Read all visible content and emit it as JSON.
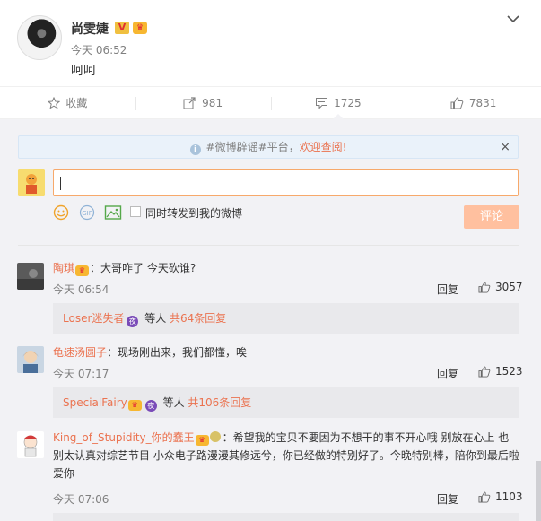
{
  "post": {
    "author": "尚雯婕",
    "vip_badge": "V",
    "time": "今天 06:52",
    "text": "呵呵"
  },
  "actions": {
    "favorite": "收藏",
    "repost": "981",
    "comment": "1725",
    "like": "7831"
  },
  "notice": {
    "prefix": "#微博辟谣#平台，",
    "link": "欢迎查阅!",
    "close": "×"
  },
  "composer": {
    "sync_label": "同时转发到我的微博",
    "submit_label": "评论"
  },
  "comments": [
    {
      "user": "陶琪",
      "text": "：大哥咋了 今天砍谁?",
      "time": "今天 06:54",
      "reply_label": "回复",
      "likes": "3057",
      "sub_user": "Loser迷失者",
      "sub_mid": " 等人 ",
      "sub_more": "共64条回复"
    },
    {
      "user": "龟速汤圆子",
      "text": "：现场刚出来，我们都懂，唉",
      "time": "今天 07:17",
      "reply_label": "回复",
      "likes": "1523",
      "sub_user": "SpecialFairy",
      "sub_mid": " 等人 ",
      "sub_more": "共106条回复"
    },
    {
      "user": "King_of_Stupidity_你的蠢王",
      "text": "：希望我的宝贝不要因为不想干的事不开心哦 别放在心上 也别太认真对综艺节目 小众电子路漫漫其修远兮，你已经做的特别好了。今晚特别棒，陪你到最后啦爱你",
      "time": "今天 07:06",
      "reply_label": "回复",
      "likes": "1103"
    }
  ],
  "colors": {
    "accent": "#eb7350",
    "muted": "#808080",
    "bg_comments": "#f2f2f5",
    "submit_disabled": "#ffc09f"
  }
}
